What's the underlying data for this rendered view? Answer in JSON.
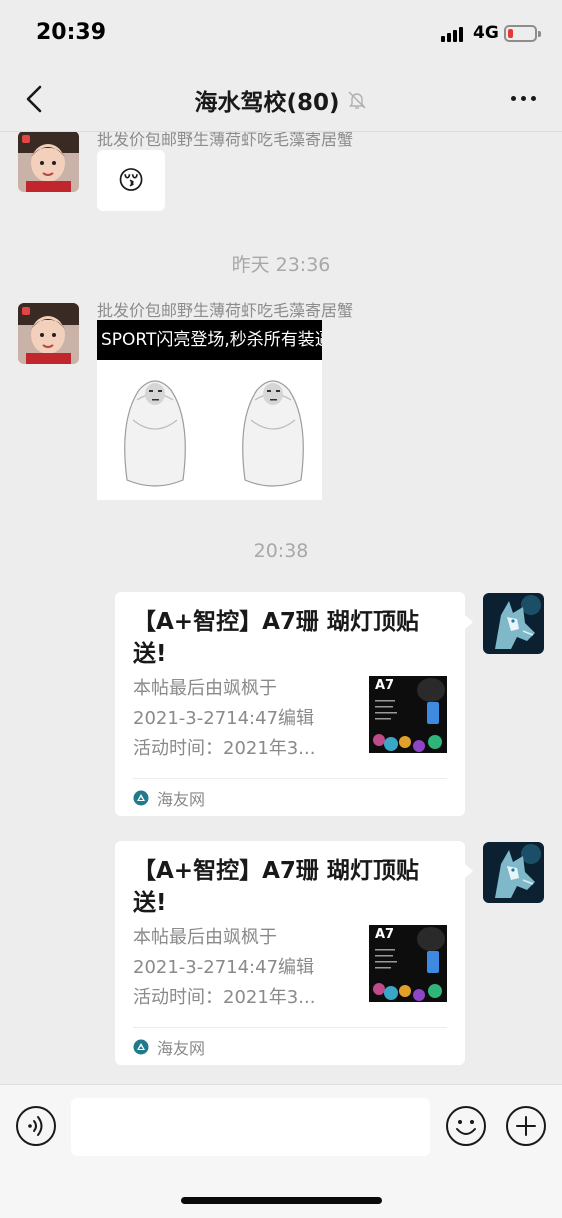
{
  "status_bar": {
    "time": "20:39",
    "network": "4G",
    "battery_color": "#e53935"
  },
  "nav": {
    "title": "海水驾校(80)",
    "back_icon": "chevron-left-icon",
    "mute_icon": "bell-off-icon",
    "more_icon": "ellipsis-icon"
  },
  "messages": [
    {
      "type": "sticker",
      "sender": "批发价包邮野生薄荷虾吃毛藻寄居蟹",
      "emoji": "😚"
    },
    {
      "type": "timestamp",
      "text": "昨天 23:36"
    },
    {
      "type": "meme_image",
      "sender": "批发价包邮野生薄荷虾吃毛藻寄居蟹",
      "caption": "SPORT闪亮登场,秒杀所有装逼佬"
    },
    {
      "type": "timestamp",
      "text": "20:38"
    },
    {
      "type": "link_card",
      "title": "【A+智控】A7珊 瑚灯顶贴送!",
      "desc_lines": [
        "本帖最后由飒枫于",
        "2021-3-2714:47编辑",
        "活动时间：2021年3..."
      ],
      "thumb_label": "A7",
      "source": "海友网"
    },
    {
      "type": "link_card",
      "title": "【A+智控】A7珊 瑚灯顶贴送!",
      "desc_lines": [
        "本帖最后由飒枫于",
        "2021-3-2714:47编辑",
        "活动时间：2021年3..."
      ],
      "thumb_label": "A7",
      "source": "海友网"
    }
  ],
  "input_bar": {
    "voice_icon": "voice-icon",
    "emoji_icon": "smiley-icon",
    "plus_icon": "plus-circle-icon",
    "input_value": ""
  }
}
